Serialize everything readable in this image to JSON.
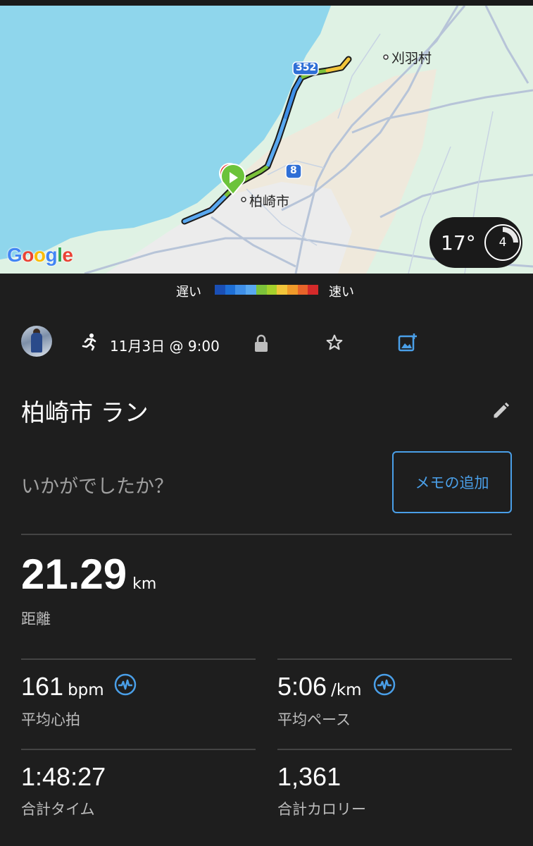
{
  "map": {
    "route_labels": {
      "highway_352": "352",
      "highway_8": "8"
    },
    "place_labels": {
      "kariwa": "刈羽村",
      "kashiwazaki": "柏崎市"
    },
    "logo_text": "Google",
    "weather": {
      "temperature": "17°",
      "wind": "4"
    }
  },
  "legend": {
    "slow": "遅い",
    "fast": "速い",
    "colors": [
      "#1a4fb5",
      "#1e6fd6",
      "#3f8fe8",
      "#59a8f0",
      "#7cc23a",
      "#a6d02c",
      "#f2c53a",
      "#f09a2a",
      "#e8642a",
      "#d42a2a"
    ]
  },
  "activity": {
    "date": "11月3日 @ 9:00",
    "title": "柏崎市 ラン",
    "prompt": "いかがでしたか？",
    "memo_button": "メモの追加"
  },
  "stats": {
    "distance": {
      "value": "21.29",
      "unit": "km",
      "label": "距離"
    },
    "heart_rate": {
      "value": "161",
      "unit": "bpm",
      "label": "平均心拍"
    },
    "pace": {
      "value": "5:06",
      "unit": "/km",
      "label": "平均ペース"
    },
    "time": {
      "value": "1:48:27",
      "label": "合計タイム"
    },
    "calories": {
      "value": "1,361",
      "label": "合計カロリー"
    }
  },
  "icon_colors": {
    "accent": "#4a9fe8"
  }
}
